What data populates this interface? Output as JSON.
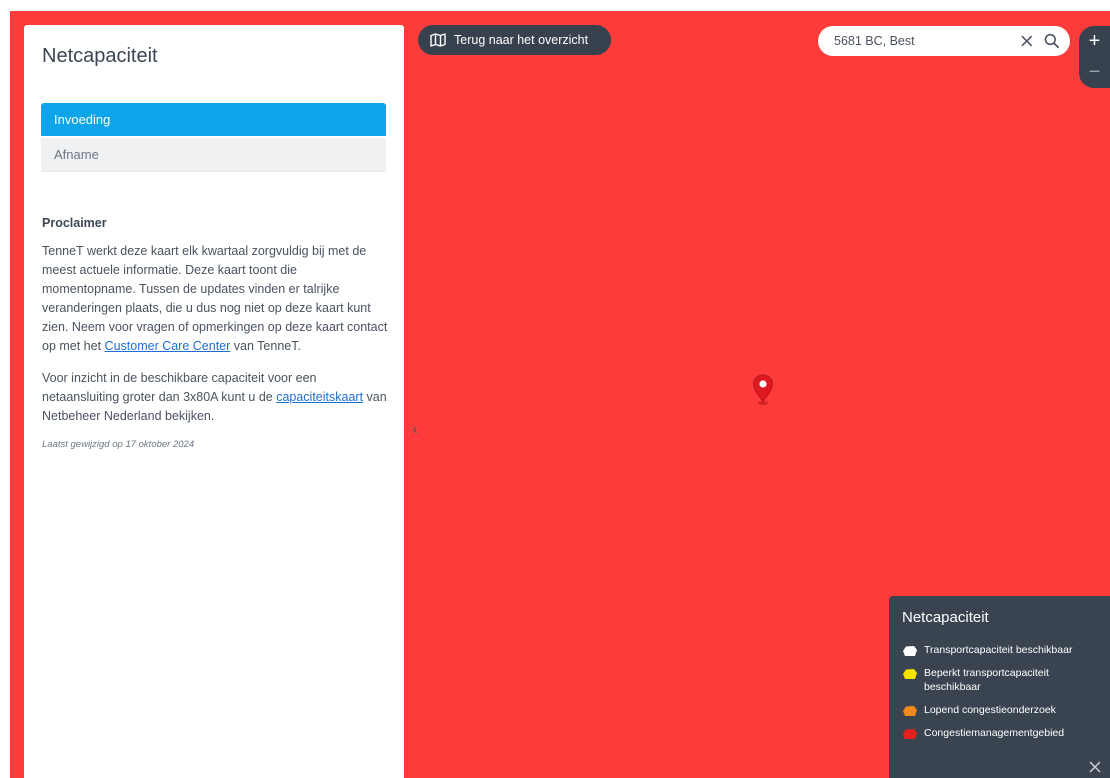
{
  "sidebar": {
    "title": "Netcapaciteit",
    "tabs": [
      {
        "label": "Invoeding",
        "active": true
      },
      {
        "label": "Afname",
        "active": false
      }
    ],
    "proclaimer": {
      "heading": "Proclaimer",
      "p1_text": "TenneT werkt deze kaart elk kwartaal zorgvuldig bij met de meest actuele informatie. Deze kaart toont die momentopname. Tussen de updates vinden er talrijke veranderingen plaats, die u dus nog niet op deze kaart kunt zien. Neem voor vragen of opmerkingen op deze kaart contact op met het ",
      "p1_link": "Customer Care Center",
      "p1_end": " van TenneT.",
      "p2_text": "Voor inzicht in de beschikbare capaciteit voor een netaansluiting groter dan 3x80A kunt u de ",
      "p2_link": "capaciteitskaart",
      "p2_end": " van Netbeheer Nederland bekijken.",
      "last_modified": "Laatst gewijzigd op 17 oktober 2024"
    },
    "collapse_glyph": "‹"
  },
  "toolbar": {
    "back_label": "Terug naar het overzicht"
  },
  "search": {
    "value": "5681 BC, Best"
  },
  "zoom": {
    "in": "+",
    "out": "−"
  },
  "legend": {
    "title": "Netcapaciteit",
    "items": [
      {
        "label": "Transportcapaciteit beschikbaar",
        "color": "#ffffff"
      },
      {
        "label": "Beperkt transportcapaciteit beschikbaar",
        "color": "#f5e400"
      },
      {
        "label": "Lopend congestieonderzoek",
        "color": "#f08a1c"
      },
      {
        "label": "Congestiemanagementgebied",
        "color": "#e3201b"
      }
    ]
  },
  "colors": {
    "map_background": "#fd3b3b",
    "accent": "#0ea4e9",
    "dark_panel": "#38414e"
  }
}
